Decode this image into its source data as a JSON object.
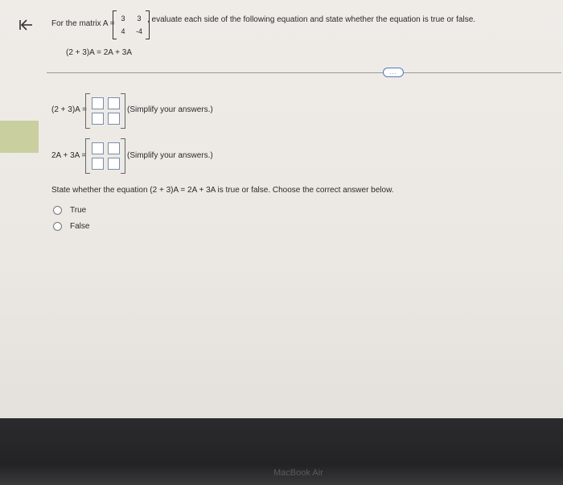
{
  "question": {
    "intro": "For the matrix A =",
    "matrix_A": [
      [
        "3",
        "3"
      ],
      [
        "4",
        "-4"
      ]
    ],
    "instruction": ", evaluate each side of the following equation and state whether the equation is true or false.",
    "equation": "(2 + 3)A = 2A + 3A"
  },
  "answers": {
    "left_label": "(2 + 3)A =",
    "right_label": "2A + 3A =",
    "hint": "(Simplify your answers.)"
  },
  "statement": "State whether the equation (2 + 3)A = 2A + 3A is true or false. Choose the correct answer below.",
  "options": [
    "True",
    "False"
  ],
  "more_button": "...",
  "brand": "MacBook Air",
  "colors": {
    "accent": "#335599",
    "side_strip": "#c9cf9e"
  }
}
